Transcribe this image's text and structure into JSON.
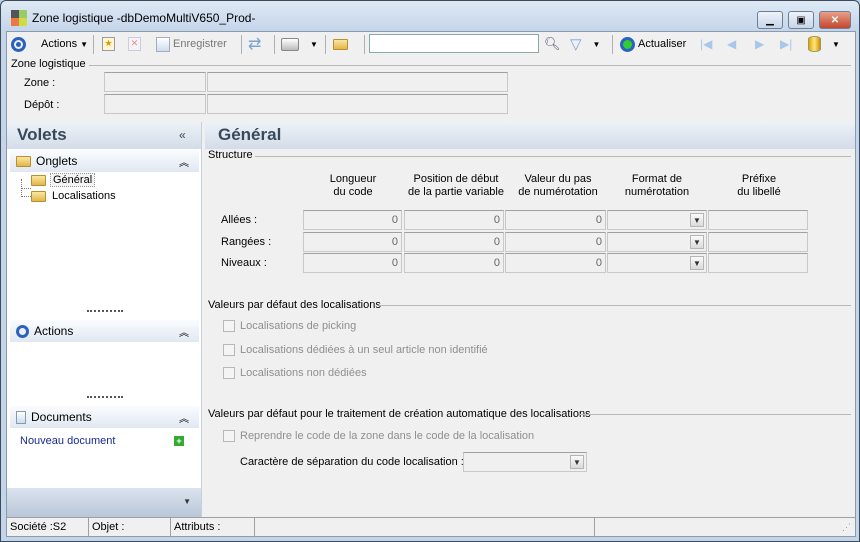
{
  "window": {
    "title": "Zone logistique -dbDemoMultiV650_Prod-"
  },
  "toolbar": {
    "actions": "Actions",
    "save": "Enregistrer",
    "search_value": "",
    "refresh": "Actualiser"
  },
  "header_group": {
    "title": "Zone logistique",
    "zone_label": "Zone :",
    "zone_value": "",
    "depot_label": "Dépôt :",
    "depot_value": ""
  },
  "sidebar": {
    "title": "Volets",
    "tabs_section": "Onglets",
    "tabs": [
      "Général",
      "Localisations"
    ],
    "actions_section": "Actions",
    "documents_section": "Documents",
    "new_document": "Nouveau document"
  },
  "main": {
    "title": "Général",
    "structure": {
      "title": "Structure",
      "columns": [
        "Longueur\ndu code",
        "Position de début\nde la partie variable",
        "Valeur du pas\nde numérotation",
        "Format de\nnumérotation",
        "Préfixe\ndu libellé"
      ],
      "rows": [
        {
          "label": "Allées :",
          "length": "0",
          "start": "0",
          "step": "0",
          "format": "",
          "prefix": ""
        },
        {
          "label": "Rangées :",
          "length": "0",
          "start": "0",
          "step": "0",
          "format": "",
          "prefix": ""
        },
        {
          "label": "Niveaux :",
          "length": "0",
          "start": "0",
          "step": "0",
          "format": "",
          "prefix": ""
        }
      ]
    },
    "defaults": {
      "title": "Valeurs par défaut des localisations",
      "options": [
        {
          "label": "Localisations de picking",
          "checked": false
        },
        {
          "label": "Localisations dédiées à un seul article non identifié",
          "checked": false
        },
        {
          "label": "Localisations non dédiées",
          "checked": false
        }
      ]
    },
    "auto": {
      "title": "Valeurs par défaut pour le traitement de création automatique des localisations",
      "reuse_label": "Reprendre le code de la zone dans le code de la localisation",
      "reuse_checked": false,
      "separator_label": "Caractère de séparation du code localisation :",
      "separator_value": ""
    }
  },
  "status": {
    "company": "Société :S2",
    "object": "Objet :",
    "attributes": "Attributs :"
  }
}
